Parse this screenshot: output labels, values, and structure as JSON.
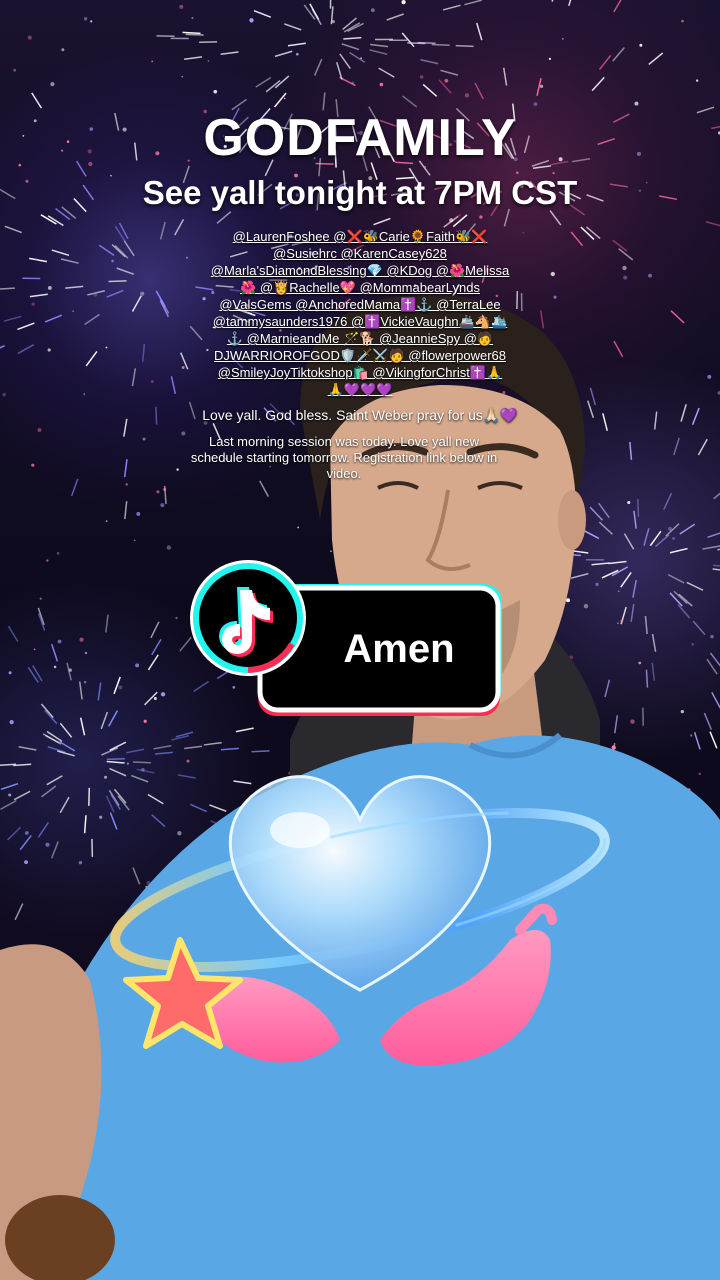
{
  "overlay": {
    "title": "GODFAMILY",
    "subtitle": "See yall tonight at 7PM CST",
    "mentions": [
      [
        {
          "t": "@"
        },
        {
          "u": "LaurenFoshee"
        },
        {
          "t": " @❌🐝"
        },
        {
          "u": "Carie"
        },
        {
          "t": "🌻"
        },
        {
          "u": "Faith"
        },
        {
          "t": "🐝❌"
        }
      ],
      [
        {
          "t": "@"
        },
        {
          "u": "Susiehrc"
        },
        {
          "t": " @"
        },
        {
          "u": "KarenCasey628"
        }
      ],
      [
        {
          "t": "@"
        },
        {
          "u": "Marla'sDiamondBlessing"
        },
        {
          "t": "💎 @"
        },
        {
          "u": "KDog"
        },
        {
          "t": " @🌺"
        },
        {
          "u": "Melissa"
        }
      ],
      [
        {
          "t": "🌺 @👸"
        },
        {
          "u": "Rachelle"
        },
        {
          "t": "💖 @"
        },
        {
          "u": "MommabearLynds"
        }
      ],
      [
        {
          "t": "@"
        },
        {
          "u": "ValsGems"
        },
        {
          "t": " @"
        },
        {
          "u": "AnchoredMama"
        },
        {
          "t": "✝️⚓ @"
        },
        {
          "u": "TerraLee"
        }
      ],
      [
        {
          "t": "@"
        },
        {
          "u": "tammysaunders1976"
        },
        {
          "t": " @✝️"
        },
        {
          "u": "VickieVaughn"
        },
        {
          "t": "🚢🐴🛳️"
        }
      ],
      [
        {
          "t": "⚓ @"
        },
        {
          "u": "MarnieandMe"
        },
        {
          "t": " 🪄🐕 @"
        },
        {
          "u": "JeannieSpy"
        },
        {
          "t": " @🧑"
        }
      ],
      [
        {
          "u": "DJWARRIOROFGOD"
        },
        {
          "t": "🛡️🗡️⚔️🧑 @"
        },
        {
          "u": "flowerpower68"
        }
      ],
      [
        {
          "t": "@"
        },
        {
          "u": "SmileyJoyTiktokshop"
        },
        {
          "t": "🛍️ @"
        },
        {
          "u": "VikingforChrist"
        },
        {
          "t": "✝️🙏"
        }
      ],
      [
        {
          "t": "🙏💜💜💜"
        }
      ]
    ],
    "blessing": "Love yall. God bless. Saint Weber pray for us🙏🏻💜",
    "note": "Last morning session was today. Love yall new schedule starting tomorrow. Registration link below in video."
  },
  "sticker": {
    "label": "Amen",
    "icon": "tiktok-logo-icon"
  },
  "effect": {
    "icon": "heart-in-hands-icon",
    "secondary_icon": "star-icon"
  },
  "colors": {
    "tiktok_cyan": "#25F4EE",
    "tiktok_red": "#FE2C55",
    "shirt_blue": "#5aa7e6"
  }
}
